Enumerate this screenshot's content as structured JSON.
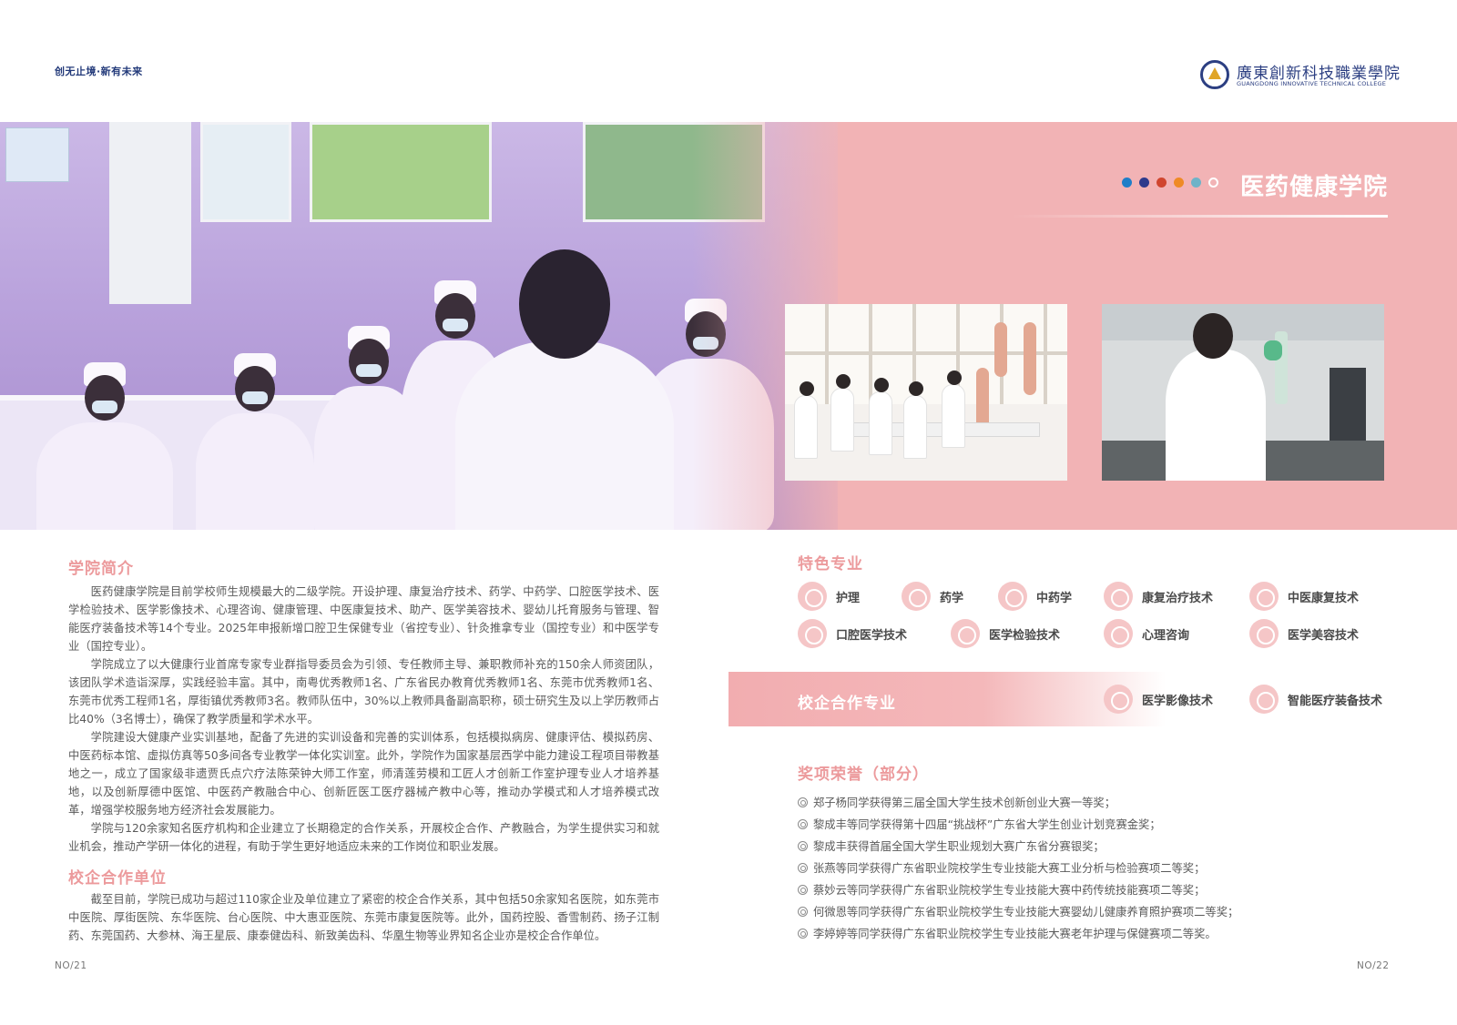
{
  "header": {
    "slogan": "创无止境·新有未来",
    "logo_cn": "廣東創新科技職業學院",
    "logo_en": "GUANGDONG INNOVATIVE TECHNICAL COLLEGE"
  },
  "banner": {
    "title": "医药健康学院",
    "dot_colors": [
      "#1f7ec8",
      "#2e3a8c",
      "#d0452e",
      "#ef8a25",
      "#6fb3c8",
      "#ffffff"
    ]
  },
  "intro": {
    "heading": "学院简介",
    "paragraphs": [
      "医药健康学院是目前学校师生规模最大的二级学院。开设护理、康复治疗技术、药学、中药学、口腔医学技术、医学检验技术、医学影像技术、心理咨询、健康管理、中医康复技术、助产、医学美容技术、婴幼儿托育服务与管理、智能医疗装备技术等14个专业。2025年申报新增口腔卫生保健专业（省控专业）、针灸推拿专业（国控专业）和中医学专业（国控专业）。",
      "学院成立了以大健康行业首席专家专业群指导委员会为引领、专任教师主导、兼职教师补充的150余人师资团队，该团队学术造诣深厚，实践经验丰富。其中，南粤优秀教师1名、广东省民办教育优秀教师1名、东莞市优秀教师1名、东莞市优秀工程师1名，厚街镇优秀教师3名。教师队伍中，30%以上教师具备副高职称，硕士研究生及以上学历教师占比40%（3名博士），确保了教学质量和学术水平。",
      "学院建设大健康产业实训基地，配备了先进的实训设备和完善的实训体系，包括模拟病房、健康评估、模拟药房、中医药标本馆、虚拟仿真等50多间各专业教学一体化实训室。此外，学院作为国家基层西学中能力建设工程项目带教基地之一，成立了国家级非遗贾氏点穴疗法陈荣钟大师工作室，师清莲劳模和工匠人才创新工作室护理专业人才培养基地，以及创新厚德中医馆、中医药产教融合中心、创新匠医工医疗器械产教中心等，推动办学模式和人才培养模式改革，增强学校服务地方经济社会发展能力。",
      "学院与120余家知名医疗机构和企业建立了长期稳定的合作关系，开展校企合作、产教融合，为学生提供实习和就业机会，推动产学研一体化的进程，有助于学生更好地适应未来的工作岗位和职业发展。"
    ]
  },
  "partners": {
    "heading": "校企合作单位",
    "paragraphs": [
      "截至目前，学院已成功与超过110家企业及单位建立了紧密的校企合作关系，其中包括50余家知名医院，如东莞市中医院、厚街医院、东华医院、台心医院、中大惠亚医院、东莞市康复医院等。此外，国药控股、香雪制药、扬子江制药、东莞国药、大参林、海王星辰、康泰健齿科、新致美齿科、华凰生物等业界知名企业亦是校企合作单位。"
    ]
  },
  "featured": {
    "heading": "特色专业",
    "majors": [
      {
        "label": "护理",
        "icon": "heart-hands-icon"
      },
      {
        "label": "药学",
        "icon": "pill-icon"
      },
      {
        "label": "中药学",
        "icon": "herb-bowl-icon"
      },
      {
        "label": "康复治疗技术",
        "icon": "wheelchair-icon"
      },
      {
        "label": "中医康复技术",
        "icon": "meditation-icon"
      },
      {
        "label": "口腔医学技术",
        "icon": "tooth-icon"
      },
      {
        "label": "医学检验技术",
        "icon": "flask-icon"
      },
      {
        "label": "心理咨询",
        "icon": "heart-icon"
      },
      {
        "label": "医学美容技术",
        "icon": "face-icon"
      }
    ]
  },
  "cooperation": {
    "heading": "校企合作专业",
    "majors": [
      {
        "label": "医学影像技术",
        "icon": "lungs-icon"
      },
      {
        "label": "智能医疗装备技术",
        "icon": "gear-heart-icon"
      }
    ]
  },
  "awards": {
    "heading": "奖项荣誉（部分）",
    "items": [
      "郑子杨同学获得第三届全国大学生技术创新创业大赛一等奖；",
      "黎成丰等同学获得第十四届“挑战杯”广东省大学生创业计划竞赛金奖；",
      "黎成丰获得首届全国大学生职业规划大赛广东省分赛银奖；",
      "张燕等同学获得广东省职业院校学生专业技能大赛工业分析与检验赛项二等奖；",
      "蔡妙云等同学获得广东省职业院校学生专业技能大赛中药传统技能赛项二等奖；",
      "何微恩等同学获得广东省职业院校学生专业技能大赛婴幼儿健康养育照护赛项二等奖；",
      "李婷婷等同学获得广东省职业院校学生专业技能大赛老年护理与保健赛项二等奖。"
    ]
  },
  "pages": {
    "left": "NO/21",
    "right": "NO/22"
  }
}
